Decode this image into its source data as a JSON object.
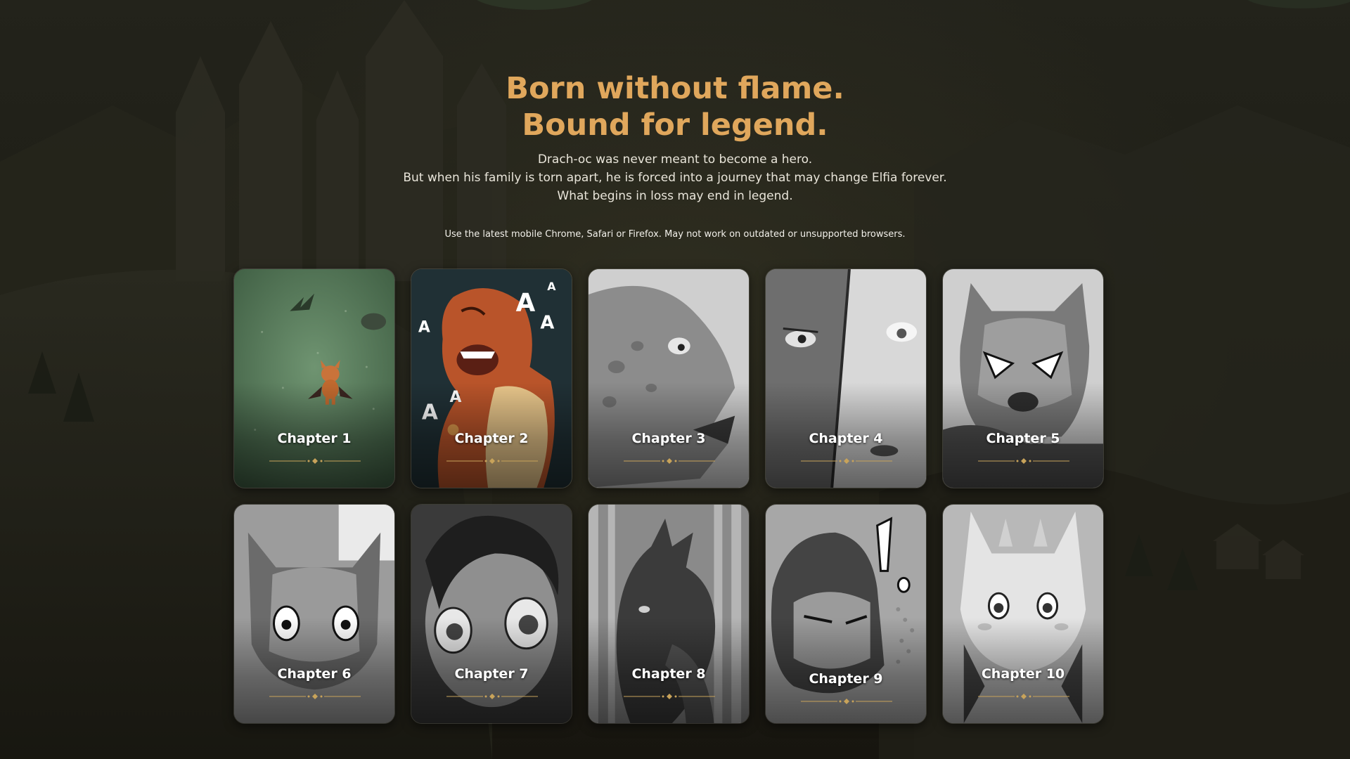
{
  "headline": {
    "line1": "Born without flame.",
    "line2": "Bound for legend."
  },
  "intro": {
    "line1": "Drach-oc was never meant to become a hero.",
    "line2": "But when his family is torn apart, he is forced into a journey that may change Elfia forever.",
    "line3": "What begins in loss may end in legend."
  },
  "notice": "Use the latest mobile Chrome, Safari or Firefox. May not work on outdated or unsupported browsers.",
  "colors": {
    "headline": "#e0a75c",
    "ornament": "#c8a35a",
    "background": "#1e1e16"
  },
  "chapters": [
    {
      "label": "Chapter 1",
      "art": "green-field-dragon",
      "style": "color"
    },
    {
      "label": "Chapter 2",
      "art": "screaming-dragon",
      "style": "color"
    },
    {
      "label": "Chapter 3",
      "art": "dragon-profile",
      "style": "grayscale"
    },
    {
      "label": "Chapter 4",
      "art": "split-faces",
      "style": "grayscale"
    },
    {
      "label": "Chapter 5",
      "art": "angry-dragon",
      "style": "grayscale"
    },
    {
      "label": "Chapter 6",
      "art": "wide-eyed-dragon",
      "style": "grayscale"
    },
    {
      "label": "Chapter 7",
      "art": "curly-haired-boy",
      "style": "grayscale"
    },
    {
      "label": "Chapter 8",
      "art": "dragon-silhouette",
      "style": "grayscale"
    },
    {
      "label": "Chapter 9",
      "art": "surprised-dragon",
      "style": "grayscale"
    },
    {
      "label": "Chapter 10",
      "art": "white-dragon",
      "style": "grayscale"
    }
  ]
}
